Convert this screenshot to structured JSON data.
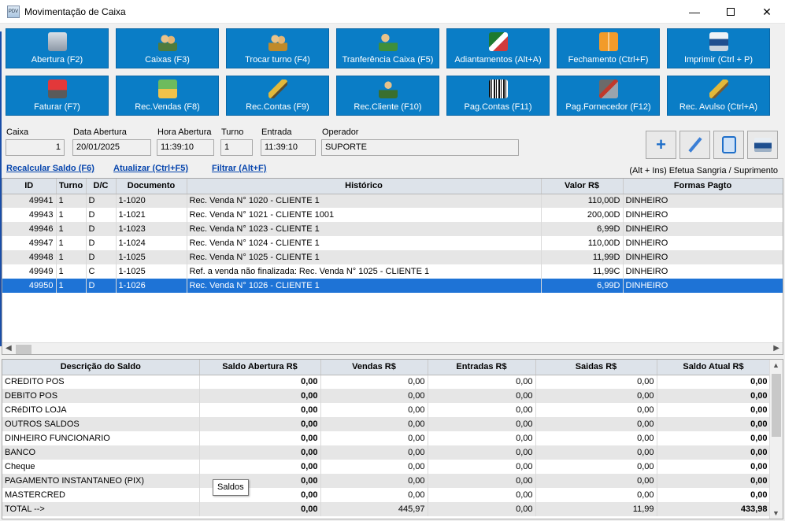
{
  "window": {
    "title": "Movimentação de Caixa",
    "icon_text": "PDV"
  },
  "toolbar": [
    {
      "label": "Abertura (F2)",
      "icon": "cash-register-icon"
    },
    {
      "label": "Caixas (F3)",
      "icon": "people-icon"
    },
    {
      "label": "Trocar turno (F4)",
      "icon": "swap-shift-icon"
    },
    {
      "label": "Tranferência Caixa (F5)",
      "icon": "transfer-icon"
    },
    {
      "label": "Adiantamentos (Alt+A)",
      "icon": "money-advance-icon"
    },
    {
      "label": "Fechamento (Ctrl+F)",
      "icon": "calculator-icon"
    },
    {
      "label": "Imprimir (Ctrl + P)",
      "icon": "printer-icon"
    },
    {
      "label": "Faturar (F7)",
      "icon": "cart-icon"
    },
    {
      "label": "Rec.Vendas (F8)",
      "icon": "sales-receipt-icon"
    },
    {
      "label": "Rec.Contas (F9)",
      "icon": "hammer-icon"
    },
    {
      "label": "Rec.Cliente (F10)",
      "icon": "client-icon"
    },
    {
      "label": "Pag.Contas (F11)",
      "icon": "barcode-icon"
    },
    {
      "label": "Pag.Fornecedor (F12)",
      "icon": "supplier-icon"
    },
    {
      "label": "Rec. Avulso (Ctrl+A)",
      "icon": "gavel-icon"
    }
  ],
  "fields": {
    "caixa": {
      "label": "Caixa",
      "value": "1"
    },
    "data_abertura": {
      "label": "Data Abertura",
      "value": "20/01/2025"
    },
    "hora_abertura": {
      "label": "Hora Abertura",
      "value": "11:39:10"
    },
    "turno": {
      "label": "Turno",
      "value": "1"
    },
    "entrada": {
      "label": "Entrada",
      "value": "11:39:10"
    },
    "operador": {
      "label": "Operador",
      "value": "SUPORTE"
    }
  },
  "links": {
    "recalcular": "Recalcular Saldo (F6)",
    "atualizar": "Atualizar (Ctrl+F5)",
    "filtrar": "Filtrar (Alt+F)"
  },
  "hint": "(Alt + Ins) Efetua Sangria / Suprimento",
  "movements": {
    "columns": [
      "ID",
      "Turno",
      "D/C",
      "Documento",
      "Histórico",
      "Valor R$",
      "Formas Pagto"
    ],
    "rows": [
      {
        "id": "49941",
        "turno": "1",
        "dc": "D",
        "doc": "1-1020",
        "hist": "Rec. Venda N° 1020 - CLIENTE 1",
        "valor": "110,00D",
        "forma": "DINHEIRO"
      },
      {
        "id": "49943",
        "turno": "1",
        "dc": "D",
        "doc": "1-1021",
        "hist": "Rec. Venda N° 1021 - CLIENTE 1001",
        "valor": "200,00D",
        "forma": "DINHEIRO"
      },
      {
        "id": "49946",
        "turno": "1",
        "dc": "D",
        "doc": "1-1023",
        "hist": "Rec. Venda N° 1023 - CLIENTE 1",
        "valor": "6,99D",
        "forma": "DINHEIRO"
      },
      {
        "id": "49947",
        "turno": "1",
        "dc": "D",
        "doc": "1-1024",
        "hist": "Rec. Venda N° 1024 - CLIENTE 1",
        "valor": "110,00D",
        "forma": "DINHEIRO"
      },
      {
        "id": "49948",
        "turno": "1",
        "dc": "D",
        "doc": "1-1025",
        "hist": "Rec. Venda N° 1025 - CLIENTE 1",
        "valor": "11,99D",
        "forma": "DINHEIRO"
      },
      {
        "id": "49949",
        "turno": "1",
        "dc": "C",
        "doc": "1-1025",
        "hist": "Ref. a venda não finalizada: Rec. Venda N° 1025 - CLIENTE 1",
        "valor": "11,99C",
        "forma": "DINHEIRO"
      },
      {
        "id": "49950",
        "turno": "1",
        "dc": "D",
        "doc": "1-1026",
        "hist": "Rec. Venda N° 1026 - CLIENTE 1",
        "valor": "6,99D",
        "forma": "DINHEIRO"
      }
    ]
  },
  "balances": {
    "columns": [
      "Descrição do Saldo",
      "Saldo Abertura R$",
      "Vendas R$",
      "Entradas R$",
      "Saidas R$",
      "Saldo Atual R$"
    ],
    "rows": [
      [
        "CREDITO POS",
        "0,00",
        "0,00",
        "0,00",
        "0,00",
        "0,00"
      ],
      [
        "DEBITO POS",
        "0,00",
        "0,00",
        "0,00",
        "0,00",
        "0,00"
      ],
      [
        "CRéDITO LOJA",
        "0,00",
        "0,00",
        "0,00",
        "0,00",
        "0,00"
      ],
      [
        "OUTROS SALDOS",
        "0,00",
        "0,00",
        "0,00",
        "0,00",
        "0,00"
      ],
      [
        "DINHEIRO FUNCIONARIO",
        "0,00",
        "0,00",
        "0,00",
        "0,00",
        "0,00"
      ],
      [
        "BANCO",
        "0,00",
        "0,00",
        "0,00",
        "0,00",
        "0,00"
      ],
      [
        "Cheque",
        "0,00",
        "0,00",
        "0,00",
        "0,00",
        "0,00"
      ],
      [
        "PAGAMENTO INSTANTANEO (PIX)",
        "0,00",
        "0,00",
        "0,00",
        "0,00",
        "0,00"
      ],
      [
        "MASTERCRED",
        "0,00",
        "0,00",
        "0,00",
        "0,00",
        "0,00"
      ],
      [
        "TOTAL  -->",
        "0,00",
        "445,97",
        "0,00",
        "11,99",
        "433,98"
      ]
    ]
  },
  "tooltip": "Saldos",
  "selected_row_index": 6,
  "colors": {
    "toolbar_button": "#0a7dc6",
    "selection": "#1e73d6",
    "link": "#0645ad"
  }
}
